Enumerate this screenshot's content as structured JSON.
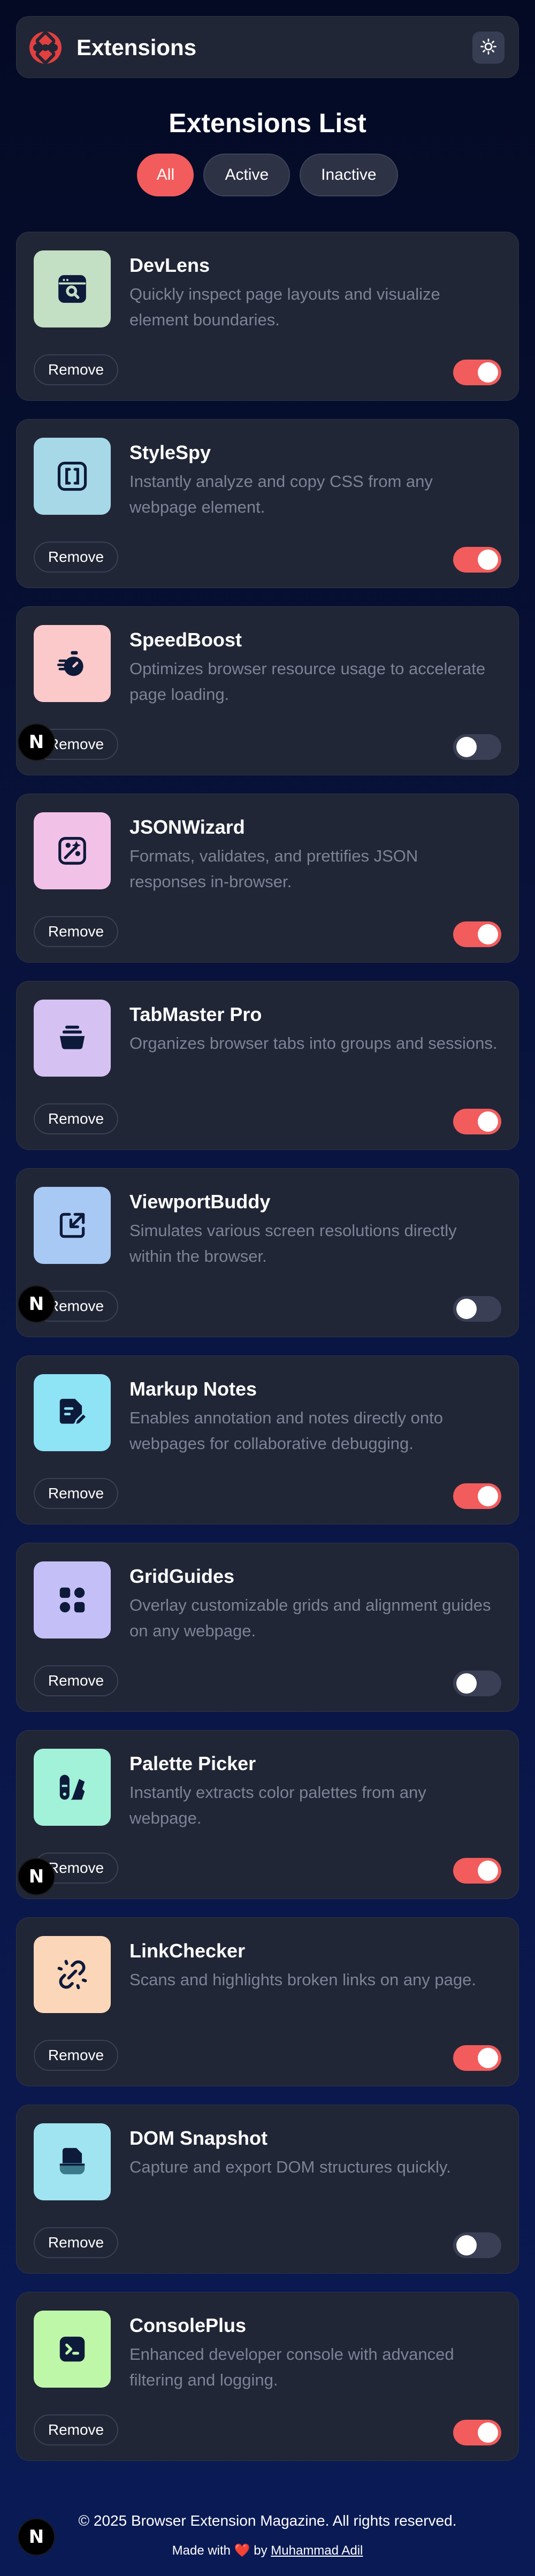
{
  "header": {
    "title": "Extensions",
    "theme_icon": "sun-icon",
    "logo_icon": "logo-icon",
    "accent": "#f25c5c"
  },
  "list": {
    "title": "Extensions List"
  },
  "filters": [
    {
      "label": "All",
      "active": true
    },
    {
      "label": "Active",
      "active": false
    },
    {
      "label": "Inactive",
      "active": false
    }
  ],
  "extensions": [
    {
      "name": "DevLens",
      "description": "Quickly inspect page layouts and visualize element boundaries.",
      "remove_label": "Remove",
      "enabled": true,
      "icon": "browser-search-icon",
      "icon_bg": "#c3dfc4"
    },
    {
      "name": "StyleSpy",
      "description": "Instantly analyze and copy CSS from any webpage element.",
      "remove_label": "Remove",
      "enabled": true,
      "icon": "brackets-icon",
      "icon_bg": "#a7d8e8"
    },
    {
      "name": "SpeedBoost",
      "description": "Optimizes browser resource usage to accelerate page loading.",
      "remove_label": "Remove",
      "enabled": false,
      "icon": "stopwatch-icon",
      "icon_bg": "#fbc9c9"
    },
    {
      "name": "JSONWizard",
      "description": "Formats, validates, and prettifies JSON responses in-browser.",
      "remove_label": "Remove",
      "enabled": true,
      "icon": "magic-wand-icon",
      "icon_bg": "#f2c1e8"
    },
    {
      "name": "TabMaster Pro",
      "description": "Organizes browser tabs into groups and sessions.",
      "remove_label": "Remove",
      "enabled": true,
      "icon": "tabs-stack-icon",
      "icon_bg": "#d5c1f2"
    },
    {
      "name": "ViewportBuddy",
      "description": "Simulates various screen resolutions directly within the browser.",
      "remove_label": "Remove",
      "enabled": false,
      "icon": "resize-icon",
      "icon_bg": "#a9c9f5"
    },
    {
      "name": "Markup Notes",
      "description": "Enables annotation and notes directly onto webpages for collaborative debugging.",
      "remove_label": "Remove",
      "enabled": true,
      "icon": "note-edit-icon",
      "icon_bg": "#8ee3f5"
    },
    {
      "name": "GridGuides",
      "description": "Overlay customizable grids and alignment guides on any webpage.",
      "remove_label": "Remove",
      "enabled": false,
      "icon": "grid-icon",
      "icon_bg": "#c5bff7"
    },
    {
      "name": "Palette Picker",
      "description": "Instantly extracts color palettes from any webpage.",
      "remove_label": "Remove",
      "enabled": true,
      "icon": "palette-icon",
      "icon_bg": "#a2f1d9"
    },
    {
      "name": "LinkChecker",
      "description": "Scans and highlights broken links on any page.",
      "remove_label": "Remove",
      "enabled": true,
      "icon": "broken-link-icon",
      "icon_bg": "#fcd6b8"
    },
    {
      "name": "DOM Snapshot",
      "description": "Capture and export DOM structures quickly.",
      "remove_label": "Remove",
      "enabled": false,
      "icon": "snapshot-icon",
      "icon_bg": "#9fe4f0"
    },
    {
      "name": "ConsolePlus",
      "description": "Enhanced developer console with advanced filtering and logging.",
      "remove_label": "Remove",
      "enabled": true,
      "icon": "terminal-icon",
      "icon_bg": "#bff7a9"
    }
  ],
  "dev_badge": {
    "letter": "N"
  },
  "footer": {
    "copyright": "© 2025 Browser Extension Magazine. All rights reserved.",
    "made_prefix": "Made with",
    "made_by": "by",
    "author": "Muhammad Adil"
  }
}
